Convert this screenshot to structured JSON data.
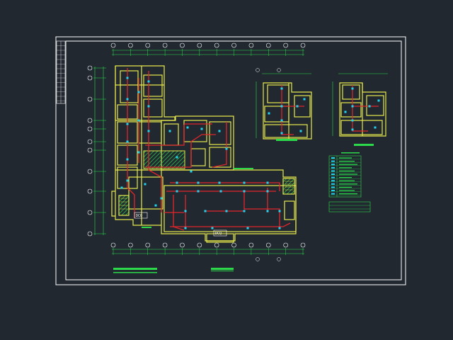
{
  "drawing": {
    "title_labels": [
      "DCQ",
      "DCQ"
    ],
    "colors": {
      "background": "#212830",
      "frame": "#ffffff",
      "wall": "#e8e84a",
      "wiring": "#e0262a",
      "device": "#22d3ee",
      "dimension": "#27e04a",
      "hatch": "#2bd94a"
    },
    "axis_bubbles_top_count": 12,
    "axis_bubbles_left_count": 11,
    "legend_rows": 12
  }
}
